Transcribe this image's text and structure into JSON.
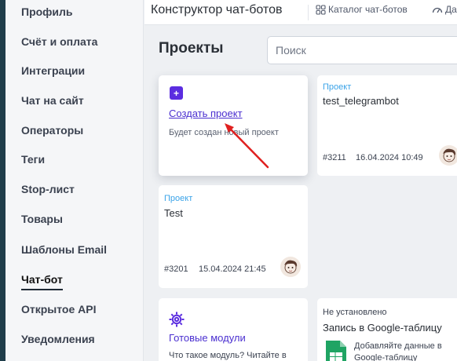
{
  "sidebar": {
    "items": [
      {
        "label": "Профиль"
      },
      {
        "label": "Счёт и оплата"
      },
      {
        "label": "Интеграции"
      },
      {
        "label": "Чат на сайт"
      },
      {
        "label": "Операторы"
      },
      {
        "label": "Теги"
      },
      {
        "label": "Stop-лист"
      },
      {
        "label": "Товары"
      },
      {
        "label": "Шаблоны Email"
      },
      {
        "label": "Чат-бот",
        "active": true
      },
      {
        "label": "Открытое API"
      },
      {
        "label": "Уведомления"
      }
    ]
  },
  "topbar": {
    "title": "Конструктор чат-ботов",
    "links": [
      {
        "label": "Каталог чат-ботов",
        "icon": "grid-icon"
      },
      {
        "label": "Да",
        "icon": "dashboard-icon"
      }
    ]
  },
  "main": {
    "title": "Проекты",
    "search": {
      "placeholder": "Поиск",
      "value": ""
    },
    "create_card": {
      "link": "Создать проект",
      "description": "Будет создан новый проект",
      "icon": "plus-icon"
    },
    "projects": [
      {
        "label": "Проект",
        "name": "test_telegrambot",
        "id": "#3211",
        "date": "16.04.2024 10:49"
      },
      {
        "label": "Проект",
        "name": "Test",
        "id": "#3201",
        "date": "15.04.2024 21:45"
      }
    ],
    "modules_card": {
      "icon": "gear-icon",
      "title": "Готовые модули",
      "description": "Что такое модуль? Читайте в"
    },
    "integration_card": {
      "status": "Не установлено",
      "title": "Запись в Google-таблицу",
      "icon": "google-sheets-icon",
      "description_lines": [
        "Добавляйте данные в",
        "Google-таблицу"
      ]
    }
  },
  "colors": {
    "accent": "#5b2de0",
    "link": "#4a2fd0",
    "project_label": "#3aa3e8",
    "arrow": "#e0201f",
    "dark_strip": "#1f3d4a"
  }
}
